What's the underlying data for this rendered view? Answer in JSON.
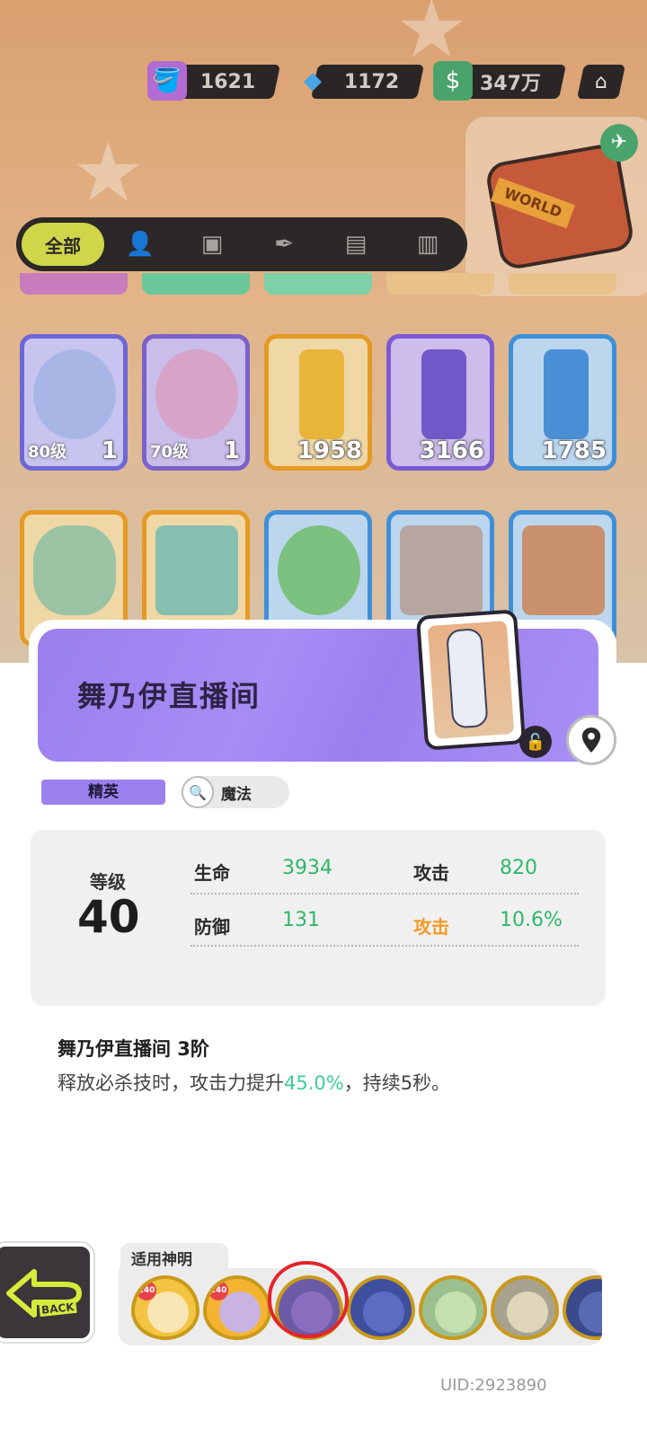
{
  "currencies": [
    {
      "icon": "paint-can-icon",
      "value": "1621"
    },
    {
      "icon": "diamond-icon",
      "value": "1172"
    },
    {
      "icon": "cash-icon",
      "value": "347万"
    }
  ],
  "shop_icon": "shop-icon",
  "world_bag": {
    "label": "WORLD"
  },
  "tabs": {
    "active": "全部",
    "icons": [
      "person-icon",
      "box-icon",
      "pen-icon",
      "card-icon",
      "book-icon"
    ]
  },
  "items_row1": [
    {
      "level": "80级",
      "count": "1",
      "color": "#6e66d6"
    },
    {
      "level": "70级",
      "count": "1",
      "color": "#7b62c9"
    },
    {
      "level": "",
      "count": "1958",
      "color": "#e49a23"
    },
    {
      "level": "",
      "count": "3166",
      "color": "#7b5ad4"
    },
    {
      "level": "",
      "count": "1785",
      "color": "#3f8fd8"
    }
  ],
  "items_row2_colors": [
    "#e49a23",
    "#e49a23",
    "#3f8fd8",
    "#3f8fd8",
    "#3f8fd8"
  ],
  "detail": {
    "title": "舞乃伊直播间",
    "rarity": "精英",
    "element": "魔法",
    "level_label": "等级",
    "level_value": "40",
    "stats": [
      {
        "name": "生命",
        "value": "3934"
      },
      {
        "name": "攻击",
        "value": "820"
      },
      {
        "name": "防御",
        "value": "131"
      },
      {
        "name": "攻击",
        "value": "10.6%"
      }
    ],
    "skill_title": "舞乃伊直播间 3阶",
    "skill_desc_before": "释放必杀技时，攻击力提升",
    "skill_desc_highlight": "45.0%",
    "skill_desc_after": "，持续5秒。"
  },
  "back_label": "BACK",
  "gods_label": "适用神明",
  "gods": [
    {
      "badge": "140"
    },
    {
      "badge": "140"
    },
    {
      "badge": ""
    },
    {
      "badge": ""
    },
    {
      "badge": ""
    },
    {
      "badge": ""
    }
  ],
  "uid": "UID:2923890",
  "colors": {
    "accent_purple": "#9b81ef",
    "stat_green": "#2fb86a",
    "stat_orange": "#f29b26",
    "highlight_teal": "#3ccf94"
  }
}
